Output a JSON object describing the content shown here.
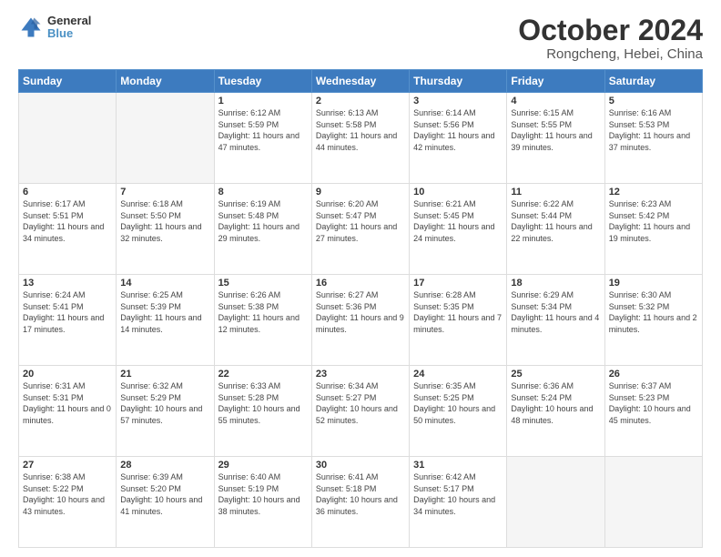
{
  "logo": {
    "line1": "General",
    "line2": "Blue"
  },
  "title": "October 2024",
  "subtitle": "Rongcheng, Hebei, China",
  "weekdays": [
    "Sunday",
    "Monday",
    "Tuesday",
    "Wednesday",
    "Thursday",
    "Friday",
    "Saturday"
  ],
  "weeks": [
    [
      {
        "day": "",
        "empty": true
      },
      {
        "day": "",
        "empty": true
      },
      {
        "day": "1",
        "sunrise": "Sunrise: 6:12 AM",
        "sunset": "Sunset: 5:59 PM",
        "daylight": "Daylight: 11 hours and 47 minutes."
      },
      {
        "day": "2",
        "sunrise": "Sunrise: 6:13 AM",
        "sunset": "Sunset: 5:58 PM",
        "daylight": "Daylight: 11 hours and 44 minutes."
      },
      {
        "day": "3",
        "sunrise": "Sunrise: 6:14 AM",
        "sunset": "Sunset: 5:56 PM",
        "daylight": "Daylight: 11 hours and 42 minutes."
      },
      {
        "day": "4",
        "sunrise": "Sunrise: 6:15 AM",
        "sunset": "Sunset: 5:55 PM",
        "daylight": "Daylight: 11 hours and 39 minutes."
      },
      {
        "day": "5",
        "sunrise": "Sunrise: 6:16 AM",
        "sunset": "Sunset: 5:53 PM",
        "daylight": "Daylight: 11 hours and 37 minutes."
      }
    ],
    [
      {
        "day": "6",
        "sunrise": "Sunrise: 6:17 AM",
        "sunset": "Sunset: 5:51 PM",
        "daylight": "Daylight: 11 hours and 34 minutes."
      },
      {
        "day": "7",
        "sunrise": "Sunrise: 6:18 AM",
        "sunset": "Sunset: 5:50 PM",
        "daylight": "Daylight: 11 hours and 32 minutes."
      },
      {
        "day": "8",
        "sunrise": "Sunrise: 6:19 AM",
        "sunset": "Sunset: 5:48 PM",
        "daylight": "Daylight: 11 hours and 29 minutes."
      },
      {
        "day": "9",
        "sunrise": "Sunrise: 6:20 AM",
        "sunset": "Sunset: 5:47 PM",
        "daylight": "Daylight: 11 hours and 27 minutes."
      },
      {
        "day": "10",
        "sunrise": "Sunrise: 6:21 AM",
        "sunset": "Sunset: 5:45 PM",
        "daylight": "Daylight: 11 hours and 24 minutes."
      },
      {
        "day": "11",
        "sunrise": "Sunrise: 6:22 AM",
        "sunset": "Sunset: 5:44 PM",
        "daylight": "Daylight: 11 hours and 22 minutes."
      },
      {
        "day": "12",
        "sunrise": "Sunrise: 6:23 AM",
        "sunset": "Sunset: 5:42 PM",
        "daylight": "Daylight: 11 hours and 19 minutes."
      }
    ],
    [
      {
        "day": "13",
        "sunrise": "Sunrise: 6:24 AM",
        "sunset": "Sunset: 5:41 PM",
        "daylight": "Daylight: 11 hours and 17 minutes."
      },
      {
        "day": "14",
        "sunrise": "Sunrise: 6:25 AM",
        "sunset": "Sunset: 5:39 PM",
        "daylight": "Daylight: 11 hours and 14 minutes."
      },
      {
        "day": "15",
        "sunrise": "Sunrise: 6:26 AM",
        "sunset": "Sunset: 5:38 PM",
        "daylight": "Daylight: 11 hours and 12 minutes."
      },
      {
        "day": "16",
        "sunrise": "Sunrise: 6:27 AM",
        "sunset": "Sunset: 5:36 PM",
        "daylight": "Daylight: 11 hours and 9 minutes."
      },
      {
        "day": "17",
        "sunrise": "Sunrise: 6:28 AM",
        "sunset": "Sunset: 5:35 PM",
        "daylight": "Daylight: 11 hours and 7 minutes."
      },
      {
        "day": "18",
        "sunrise": "Sunrise: 6:29 AM",
        "sunset": "Sunset: 5:34 PM",
        "daylight": "Daylight: 11 hours and 4 minutes."
      },
      {
        "day": "19",
        "sunrise": "Sunrise: 6:30 AM",
        "sunset": "Sunset: 5:32 PM",
        "daylight": "Daylight: 11 hours and 2 minutes."
      }
    ],
    [
      {
        "day": "20",
        "sunrise": "Sunrise: 6:31 AM",
        "sunset": "Sunset: 5:31 PM",
        "daylight": "Daylight: 11 hours and 0 minutes."
      },
      {
        "day": "21",
        "sunrise": "Sunrise: 6:32 AM",
        "sunset": "Sunset: 5:29 PM",
        "daylight": "Daylight: 10 hours and 57 minutes."
      },
      {
        "day": "22",
        "sunrise": "Sunrise: 6:33 AM",
        "sunset": "Sunset: 5:28 PM",
        "daylight": "Daylight: 10 hours and 55 minutes."
      },
      {
        "day": "23",
        "sunrise": "Sunrise: 6:34 AM",
        "sunset": "Sunset: 5:27 PM",
        "daylight": "Daylight: 10 hours and 52 minutes."
      },
      {
        "day": "24",
        "sunrise": "Sunrise: 6:35 AM",
        "sunset": "Sunset: 5:25 PM",
        "daylight": "Daylight: 10 hours and 50 minutes."
      },
      {
        "day": "25",
        "sunrise": "Sunrise: 6:36 AM",
        "sunset": "Sunset: 5:24 PM",
        "daylight": "Daylight: 10 hours and 48 minutes."
      },
      {
        "day": "26",
        "sunrise": "Sunrise: 6:37 AM",
        "sunset": "Sunset: 5:23 PM",
        "daylight": "Daylight: 10 hours and 45 minutes."
      }
    ],
    [
      {
        "day": "27",
        "sunrise": "Sunrise: 6:38 AM",
        "sunset": "Sunset: 5:22 PM",
        "daylight": "Daylight: 10 hours and 43 minutes."
      },
      {
        "day": "28",
        "sunrise": "Sunrise: 6:39 AM",
        "sunset": "Sunset: 5:20 PM",
        "daylight": "Daylight: 10 hours and 41 minutes."
      },
      {
        "day": "29",
        "sunrise": "Sunrise: 6:40 AM",
        "sunset": "Sunset: 5:19 PM",
        "daylight": "Daylight: 10 hours and 38 minutes."
      },
      {
        "day": "30",
        "sunrise": "Sunrise: 6:41 AM",
        "sunset": "Sunset: 5:18 PM",
        "daylight": "Daylight: 10 hours and 36 minutes."
      },
      {
        "day": "31",
        "sunrise": "Sunrise: 6:42 AM",
        "sunset": "Sunset: 5:17 PM",
        "daylight": "Daylight: 10 hours and 34 minutes."
      },
      {
        "day": "",
        "empty": true
      },
      {
        "day": "",
        "empty": true
      }
    ]
  ]
}
